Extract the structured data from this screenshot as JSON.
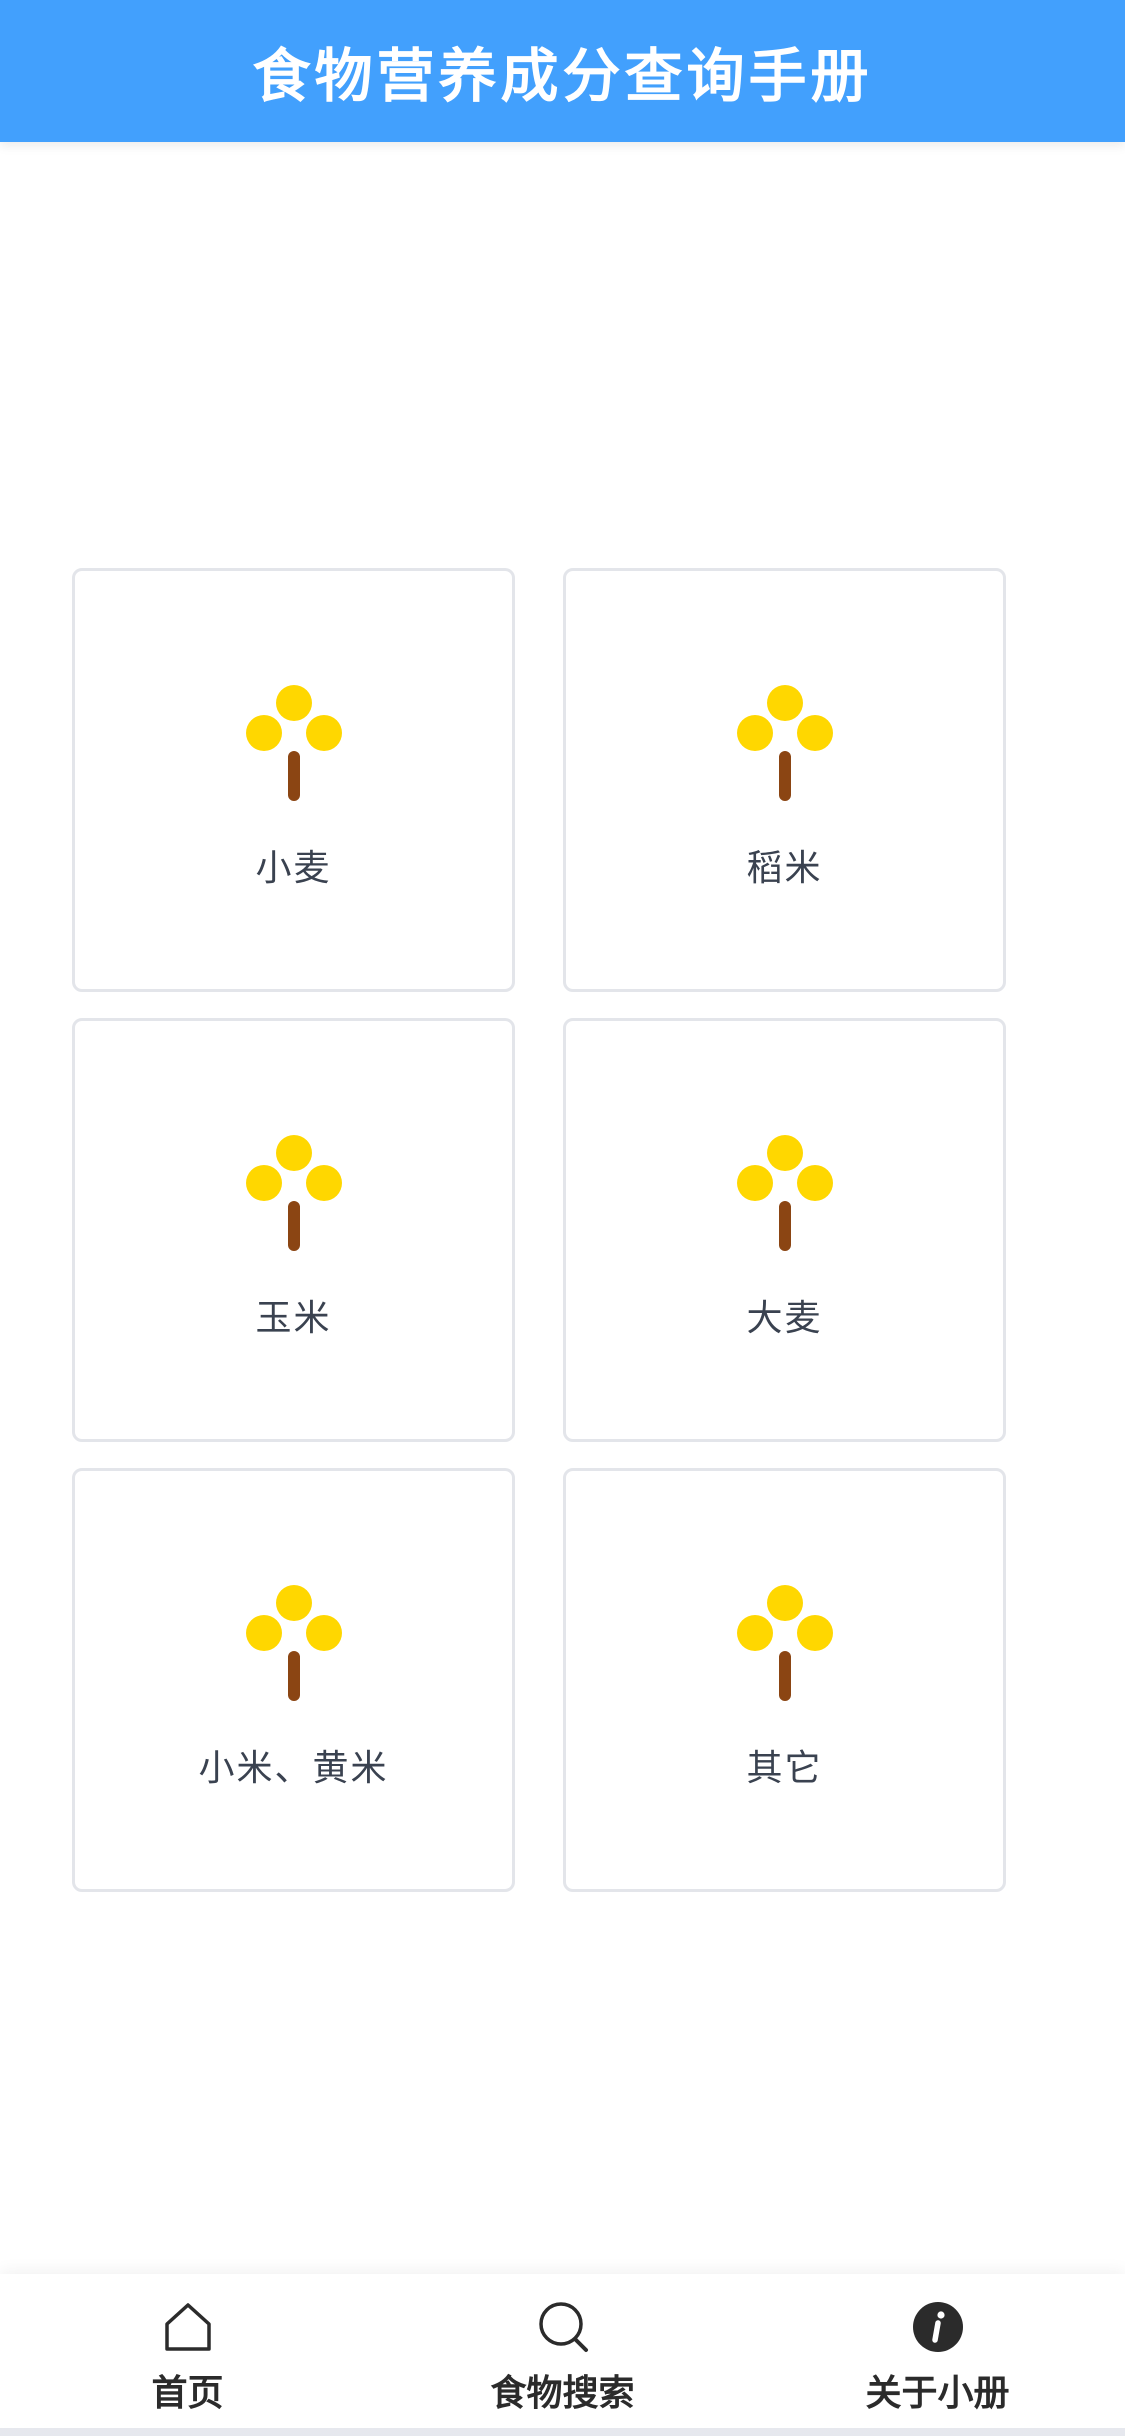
{
  "header": {
    "title": "食物营养成分查询手册"
  },
  "categories": [
    {
      "label": "小麦",
      "icon": "grain-tree-icon"
    },
    {
      "label": "稻米",
      "icon": "grain-tree-icon"
    },
    {
      "label": "玉米",
      "icon": "grain-tree-icon"
    },
    {
      "label": "大麦",
      "icon": "grain-tree-icon"
    },
    {
      "label": "小米、黄米",
      "icon": "grain-tree-icon"
    },
    {
      "label": "其它",
      "icon": "grain-tree-icon"
    }
  ],
  "tabbar": {
    "items": [
      {
        "label": "首页",
        "icon": "home-icon"
      },
      {
        "label": "食物搜索",
        "icon": "search-icon"
      },
      {
        "label": "关于小册",
        "icon": "info-icon"
      }
    ]
  },
  "colors": {
    "header": "#42a0fd",
    "grain": "#ffd700",
    "stem": "#8b4513"
  }
}
